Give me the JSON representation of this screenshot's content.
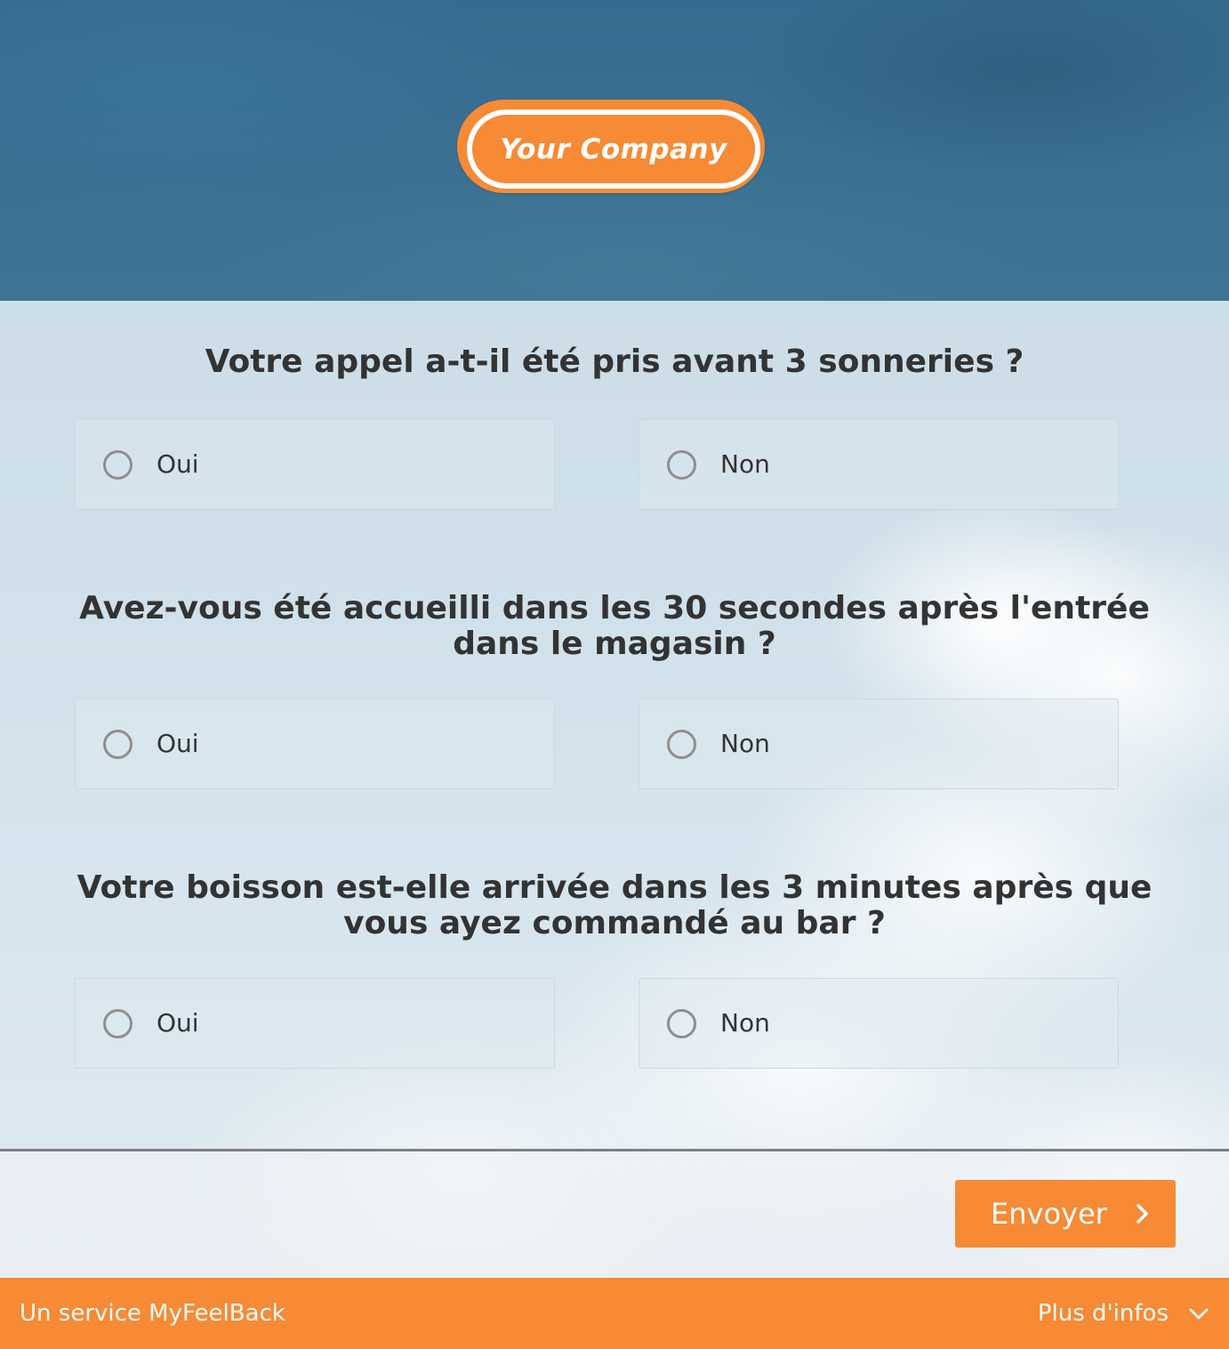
{
  "header": {
    "logo_text": "Your Company"
  },
  "questions": [
    {
      "title": "Votre appel a-t-il été pris avant 3 sonneries ?",
      "options": [
        "Oui",
        "Non"
      ]
    },
    {
      "title": "Avez-vous été accueilli dans les 30 secondes après l'entrée dans le magasin ?",
      "options": [
        "Oui",
        "Non"
      ]
    },
    {
      "title": "Votre boisson est-elle arrivée dans les 3 minutes après que vous ayez commandé au bar ?",
      "options": [
        "Oui",
        "Non"
      ]
    }
  ],
  "footer": {
    "submit_label": "Envoyer",
    "submit_icon": "chevron-right-icon",
    "service_text": "Un service MyFeelBack",
    "more_info_label": "Plus d'infos",
    "more_info_icon": "chevron-down-icon"
  },
  "colors": {
    "accent": "#f68a35",
    "header_bg": "#3a7091",
    "text": "#333333",
    "radio_border": "#8f8f8f"
  }
}
